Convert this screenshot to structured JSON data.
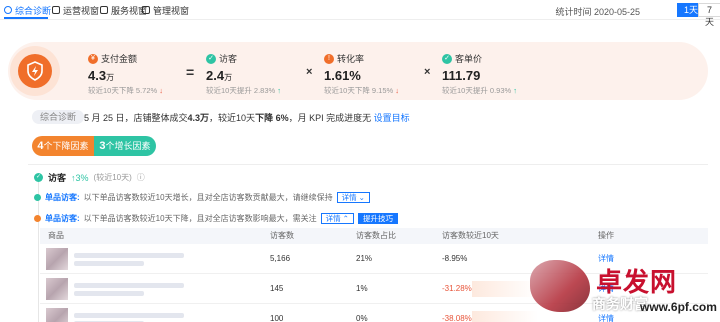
{
  "nav": {
    "tabs": [
      {
        "label": "综合诊断",
        "active": true
      },
      {
        "label": "运营视窗"
      },
      {
        "label": "服务视窗"
      },
      {
        "label": "管理视窗"
      }
    ],
    "stat_time": "统计时间 2020-05-25",
    "day_buttons": [
      {
        "label": "1天",
        "active": true
      },
      {
        "label": "7天"
      }
    ]
  },
  "formula": {
    "metrics": [
      {
        "name": "支付金额",
        "value": "4.3",
        "unit": "万",
        "compare": "较近10天下降 5.72%",
        "arrow": "↓",
        "badge_color": "#f06e2a"
      },
      {
        "name": "访客",
        "value": "2.4",
        "unit": "万",
        "compare": "较近10天提升 2.83%",
        "arrow": "↑",
        "badge_color": "#2ec4a4"
      },
      {
        "name": "转化率",
        "value": "1.61%",
        "unit": "",
        "compare": "较近10天下降 9.15%",
        "arrow": "↓",
        "badge_color": "#f06e2a"
      },
      {
        "name": "客单价",
        "value": "111.79",
        "unit": "",
        "compare": "较近10天提升 0.93%",
        "arrow": "↑",
        "badge_color": "#2ec4a4"
      }
    ],
    "operators": [
      "=",
      "×",
      "×"
    ]
  },
  "diagnosis": {
    "tag": "综合诊断",
    "text_prefix": "5 月 25 日，店铺整体成交",
    "amount": "4.3万",
    "text_mid": "，较近10天",
    "trend": "下降 6%",
    "text_suffix": "，月 KPI 完成进度无",
    "link": "设置目标"
  },
  "factors": {
    "down_count": "4",
    "down_label": "个下降因素",
    "up_count": "3",
    "up_label": "个增长因素"
  },
  "visitors": {
    "title": "访客",
    "change": "↑3%",
    "note": "(较近10天)",
    "items": [
      {
        "label": "单品访客:",
        "desc": "以下单品访客数较近10天增长，且对全店访客数贡献最大，请继续保持",
        "button": "详情",
        "dot_color": "#2ec4a4"
      },
      {
        "label": "单品访客:",
        "desc": "以下单品访客数较近10天下降，且对全店访客数影响最大，需关注",
        "button": "详情",
        "button2": "提升技巧",
        "dot_color": "#f3842e"
      }
    ]
  },
  "table": {
    "headers": [
      "商品",
      "访客数",
      "访客数占比",
      "访客数较近10天",
      "操作"
    ],
    "rows": [
      {
        "visitors": "5,166",
        "share": "21%",
        "change": "-8.95%",
        "action": "详情",
        "highlight": false
      },
      {
        "visitors": "145",
        "share": "1%",
        "change": "-31.28%",
        "action": "详情",
        "highlight": true
      },
      {
        "visitors": "100",
        "share": "0%",
        "change": "-38.08%",
        "action": "详情",
        "highlight": true
      }
    ]
  },
  "watermark": {
    "title": "卓发网",
    "sub": "商务财富",
    "url": "www.6pf.com"
  }
}
